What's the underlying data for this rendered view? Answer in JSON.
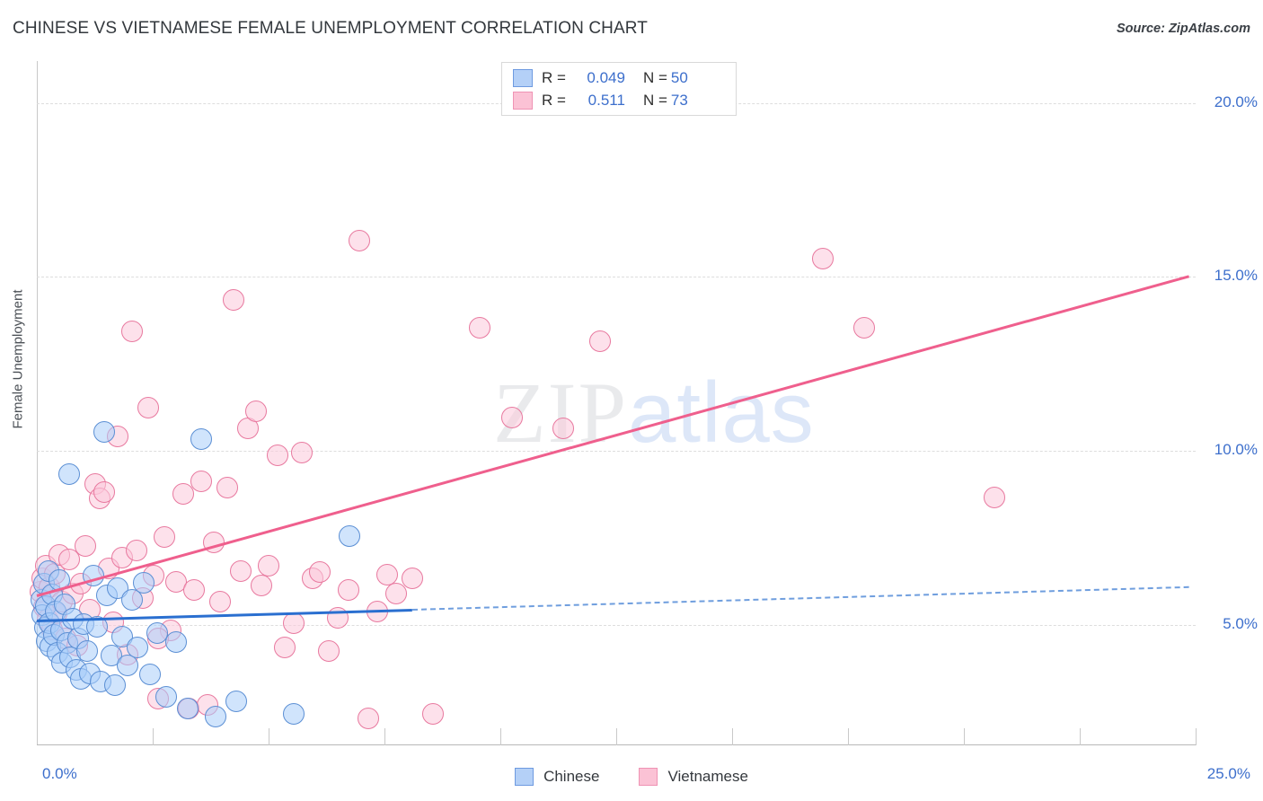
{
  "header": {
    "title": "CHINESE VS VIETNAMESE FEMALE UNEMPLOYMENT CORRELATION CHART",
    "source": "Source: ZipAtlas.com"
  },
  "watermark": {
    "part1": "ZIP",
    "part2": "atlas"
  },
  "stats_legend": {
    "rows": [
      {
        "series": "Chinese",
        "color": "#b4d0f7",
        "r_label": "R =",
        "r_value": "0.049",
        "n_label": "N =",
        "n_value": "50"
      },
      {
        "series": "Vietnamese",
        "color": "#fbc2d5",
        "r_label": "R =",
        "r_value": "0.511",
        "n_label": "N =",
        "n_value": "73"
      }
    ]
  },
  "bottom_legend": {
    "items": [
      {
        "label": "Chinese",
        "color": "#b4d0f7"
      },
      {
        "label": "Vietnamese",
        "color": "#fbc2d5"
      }
    ]
  },
  "chart_data": {
    "type": "scatter",
    "title": "CHINESE VS VIETNAMESE FEMALE UNEMPLOYMENT CORRELATION CHART",
    "xlabel": "",
    "ylabel": "Female Unemployment",
    "xlim": [
      0.0,
      25.0
    ],
    "ylim": [
      1.55,
      21.2
    ],
    "x_unit": "%",
    "y_unit": "%",
    "grid": true,
    "y_axis_side": "right",
    "x_tick_labels": [
      "0.0%",
      "25.0%"
    ],
    "y_tick_labels": [
      "5.0%",
      "10.0%",
      "15.0%",
      "20.0%"
    ],
    "y_ticks": [
      5.0,
      10.0,
      15.0,
      20.0
    ],
    "legend_position": "bottom-center",
    "series": [
      {
        "name": "Chinese",
        "color": "#aacdfa",
        "edge_color": "#5b8fd4",
        "r": 0.049,
        "n": 50,
        "trend": {
          "solid": {
            "x0": 0.0,
            "y0": 5.17,
            "x1": 8.1,
            "y1": 5.48
          },
          "dashed": {
            "x0": 8.1,
            "y0": 5.48,
            "x1": 24.85,
            "y1": 6.13
          }
        },
        "points": [
          [
            0.1,
            5.72
          ],
          [
            0.12,
            5.3
          ],
          [
            0.15,
            6.18
          ],
          [
            0.18,
            4.92
          ],
          [
            0.2,
            5.55
          ],
          [
            0.22,
            4.55
          ],
          [
            0.25,
            6.55
          ],
          [
            0.28,
            5.05
          ],
          [
            0.3,
            4.38
          ],
          [
            0.33,
            5.88
          ],
          [
            0.36,
            4.72
          ],
          [
            0.4,
            5.4
          ],
          [
            0.45,
            4.2
          ],
          [
            0.48,
            6.3
          ],
          [
            0.52,
            4.85
          ],
          [
            0.55,
            3.92
          ],
          [
            0.6,
            5.6
          ],
          [
            0.65,
            4.48
          ],
          [
            0.7,
            9.35
          ],
          [
            0.72,
            4.08
          ],
          [
            0.78,
            5.18
          ],
          [
            0.85,
            3.72
          ],
          [
            0.9,
            4.62
          ],
          [
            0.95,
            3.45
          ],
          [
            1.0,
            5.02
          ],
          [
            1.08,
            4.25
          ],
          [
            1.15,
            3.62
          ],
          [
            1.22,
            6.42
          ],
          [
            1.3,
            4.95
          ],
          [
            1.38,
            3.38
          ],
          [
            1.45,
            10.55
          ],
          [
            1.52,
            5.85
          ],
          [
            1.6,
            4.12
          ],
          [
            1.68,
            3.28
          ],
          [
            1.75,
            6.05
          ],
          [
            1.85,
            4.68
          ],
          [
            1.95,
            3.85
          ],
          [
            2.05,
            5.72
          ],
          [
            2.18,
            4.35
          ],
          [
            2.3,
            6.22
          ],
          [
            2.45,
            3.58
          ],
          [
            2.6,
            4.78
          ],
          [
            2.8,
            2.95
          ],
          [
            3.0,
            4.52
          ],
          [
            3.25,
            2.62
          ],
          [
            3.55,
            10.35
          ],
          [
            3.85,
            2.38
          ],
          [
            4.3,
            2.82
          ],
          [
            5.55,
            2.45
          ],
          [
            6.75,
            7.55
          ]
        ]
      },
      {
        "name": "Vietnamese",
        "color": "#fcc8da",
        "edge_color": "#e8799f",
        "r": 0.511,
        "n": 73,
        "trend": {
          "x0": 0.0,
          "y0": 5.88,
          "x1": 24.85,
          "y1": 15.05
        },
        "points": [
          [
            0.08,
            5.95
          ],
          [
            0.12,
            6.35
          ],
          [
            0.16,
            5.52
          ],
          [
            0.2,
            6.72
          ],
          [
            0.24,
            5.15
          ],
          [
            0.28,
            6.08
          ],
          [
            0.32,
            4.88
          ],
          [
            0.38,
            6.48
          ],
          [
            0.42,
            5.35
          ],
          [
            0.48,
            7.02
          ],
          [
            0.55,
            5.68
          ],
          [
            0.62,
            4.62
          ],
          [
            0.7,
            6.88
          ],
          [
            0.78,
            5.92
          ],
          [
            0.88,
            4.42
          ],
          [
            0.95,
            6.18
          ],
          [
            1.05,
            7.28
          ],
          [
            1.15,
            5.45
          ],
          [
            1.25,
            9.05
          ],
          [
            1.35,
            8.65
          ],
          [
            1.45,
            8.82
          ],
          [
            1.55,
            6.62
          ],
          [
            1.65,
            5.08
          ],
          [
            1.75,
            10.42
          ],
          [
            1.85,
            6.95
          ],
          [
            1.95,
            4.15
          ],
          [
            2.05,
            13.45
          ],
          [
            2.15,
            7.15
          ],
          [
            2.28,
            5.78
          ],
          [
            2.4,
            11.25
          ],
          [
            2.52,
            6.42
          ],
          [
            2.62,
            2.88
          ],
          [
            2.75,
            7.52
          ],
          [
            2.88,
            4.85
          ],
          [
            3.0,
            6.25
          ],
          [
            3.15,
            8.78
          ],
          [
            3.28,
            2.62
          ],
          [
            3.4,
            6.02
          ],
          [
            3.55,
            9.12
          ],
          [
            3.68,
            2.72
          ],
          [
            3.82,
            7.38
          ],
          [
            3.95,
            5.68
          ],
          [
            4.1,
            8.95
          ],
          [
            4.25,
            14.35
          ],
          [
            4.4,
            6.55
          ],
          [
            4.55,
            10.65
          ],
          [
            4.72,
            11.15
          ],
          [
            4.85,
            6.15
          ],
          [
            5.0,
            6.72
          ],
          [
            5.2,
            9.88
          ],
          [
            5.35,
            4.35
          ],
          [
            5.55,
            5.05
          ],
          [
            5.72,
            9.95
          ],
          [
            5.95,
            6.35
          ],
          [
            6.1,
            6.52
          ],
          [
            6.3,
            4.25
          ],
          [
            6.5,
            5.22
          ],
          [
            6.72,
            6.02
          ],
          [
            6.95,
            16.05
          ],
          [
            7.15,
            2.32
          ],
          [
            7.35,
            5.38
          ],
          [
            7.55,
            6.45
          ],
          [
            7.75,
            5.92
          ],
          [
            8.1,
            6.35
          ],
          [
            8.55,
            2.45
          ],
          [
            9.55,
            13.55
          ],
          [
            10.25,
            10.95
          ],
          [
            11.35,
            10.65
          ],
          [
            12.15,
            13.15
          ],
          [
            16.95,
            15.52
          ],
          [
            17.85,
            13.55
          ],
          [
            20.65,
            8.68
          ],
          [
            2.62,
            4.62
          ]
        ]
      }
    ]
  }
}
